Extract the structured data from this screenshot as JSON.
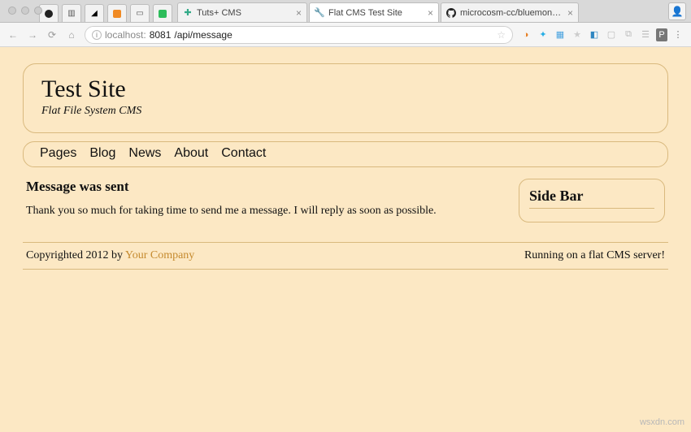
{
  "browser": {
    "tabs": [
      {
        "title": "Tuts+ CMS"
      },
      {
        "title": "Flat CMS Test Site"
      },
      {
        "title": "microcosm-cc/bluemonday: bl"
      }
    ],
    "url_prefix": "localhost:",
    "url_port": "8081",
    "url_path": "/api/message",
    "star": "☆"
  },
  "page": {
    "site_title": "Test Site",
    "site_subtitle": "Flat File System CMS",
    "nav": [
      "Pages",
      "Blog",
      "News",
      "About",
      "Contact"
    ],
    "msg_heading": "Message was sent",
    "msg_body": "Thank you so much for taking time to send me a message. I will reply as soon as possible.",
    "sidebar_title": "Side Bar",
    "footer_left_prefix": "Copyrighted 2012 by ",
    "footer_company": "Your Company",
    "footer_right": "Running on a flat CMS server!"
  },
  "watermark": "wsxdn.com"
}
